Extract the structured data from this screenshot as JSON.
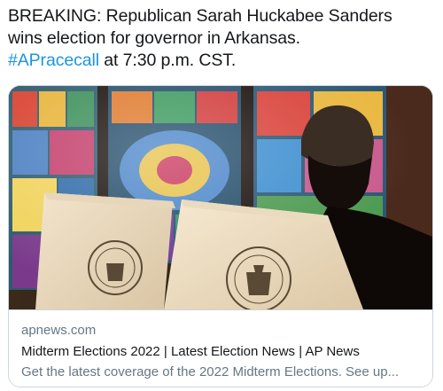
{
  "tweet": {
    "line1": "BREAKING: Republican Sarah Huckabee Sanders",
    "line2": "wins election for governor in Arkansas.",
    "hashtag": "#APracecall",
    "line3_rest": " at 7:30 p.m. CST."
  },
  "card": {
    "domain": "apnews.com",
    "title": "Midterm Elections 2022 | Latest Election News | AP News",
    "description": "Get the latest coverage of the 2022 Midterm Elections. See up...",
    "booth_seal_left": "BOARD OF ELECTIONS",
    "booth_seal_right": "BOARD OF ELECTIONS"
  },
  "colors": {
    "text": "#14171a",
    "link": "#1b95e0",
    "muted": "#657786",
    "border": "#ccd6dd"
  }
}
